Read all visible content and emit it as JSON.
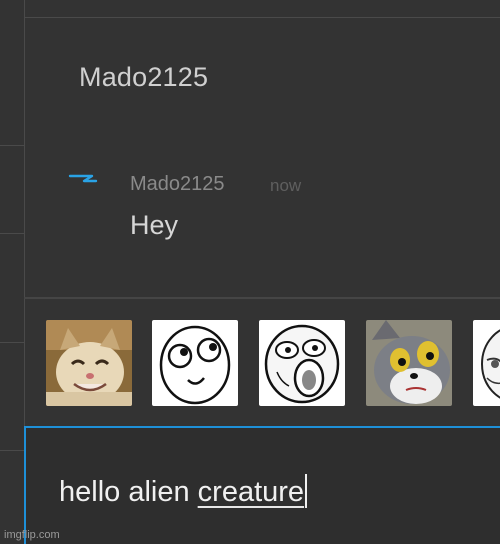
{
  "chat": {
    "title": "Mado2125"
  },
  "message": {
    "author": "Mado2125",
    "time": "now",
    "text": "Hey",
    "avatar_icon": "lightning-icon",
    "avatar_color": "#2aa3e6"
  },
  "stickers": [
    {
      "name": "smiling-cat-sticker"
    },
    {
      "name": "derp-face-sticker"
    },
    {
      "name": "lol-face-sticker"
    },
    {
      "name": "tom-cat-sticker"
    },
    {
      "name": "rage-face-sticker"
    }
  ],
  "composer": {
    "text_prefix": "hello alien ",
    "text_misspelled": "creature",
    "accent_color": "#1e90d8"
  },
  "watermark": "imgflip.com"
}
